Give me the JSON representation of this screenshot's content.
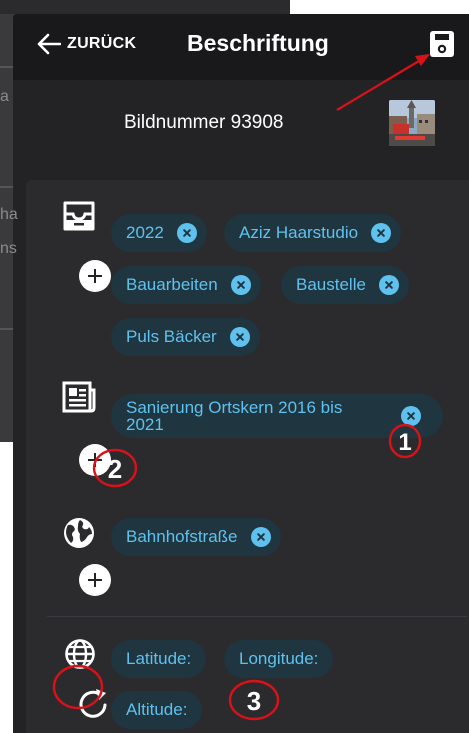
{
  "header": {
    "back_label": "ZURÜCK",
    "title": "Beschriftung",
    "save_icon": "save-icon"
  },
  "image_row": {
    "label": "Bildnummer 93908"
  },
  "sections": {
    "tags": {
      "icon": "inbox-tray-icon",
      "chips": [
        "2022",
        "Aziz Haarstudio",
        "Bauarbeiten",
        "Baustelle",
        "Puls Bäcker"
      ]
    },
    "album": {
      "icon": "newspaper-icon",
      "chips": [
        "Sanierung Ortskern 2016 bis 2021"
      ]
    },
    "location": {
      "icon": "globe-icon",
      "chips": [
        "Bahnhofstraße"
      ]
    },
    "geo": {
      "icon": "grid-globe-icon",
      "refresh_icon": "refresh-icon",
      "latitude_label": "Latitude:",
      "longitude_label": "Longitude:",
      "altitude_label": "Altitude:"
    }
  },
  "annotations": {
    "marker_1": "1",
    "marker_2": "2",
    "marker_3": "3",
    "color": "#d9121a"
  },
  "colors": {
    "chip_bg": "#1f3540",
    "chip_text": "#5fc2ee",
    "topbar_bg": "#19191b",
    "panel_bg": "#2b2b2e"
  }
}
